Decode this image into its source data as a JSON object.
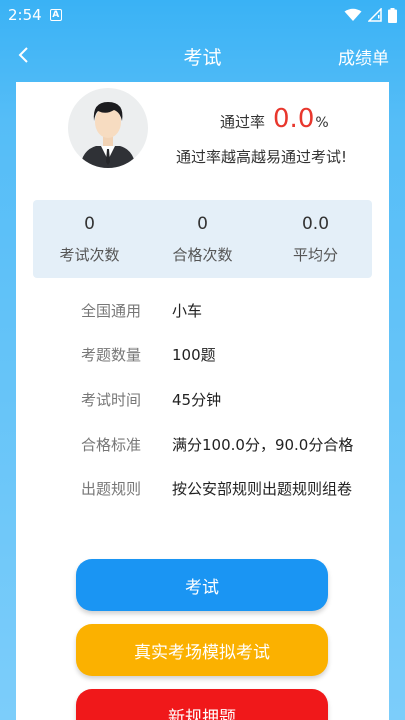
{
  "status_bar": {
    "time": "2:54",
    "notification_badge": "A"
  },
  "app_bar": {
    "title": "考试",
    "action": "成绩单"
  },
  "pass_rate": {
    "label": "通过率",
    "value": "0.0",
    "unit": "%",
    "motto": "通过率越高越易通过考试!"
  },
  "stats": [
    {
      "value": "0",
      "label": "考试次数"
    },
    {
      "value": "0",
      "label": "合格次数"
    },
    {
      "value": "0.0",
      "label": "平均分"
    }
  ],
  "info": [
    {
      "label": "全国通用",
      "value": "小车"
    },
    {
      "label": "考题数量",
      "value": "100题"
    },
    {
      "label": "考试时间",
      "value": "45分钟"
    },
    {
      "label": "合格标准",
      "value": "满分100.0分，90.0分合格"
    },
    {
      "label": "出题规则",
      "value": "按公安部规则出题规则组卷"
    }
  ],
  "buttons": {
    "exam": "考试",
    "mock": "真实考场模拟考试",
    "new_rules": "新规押题"
  },
  "colors": {
    "primary": "#1a95f3",
    "mock": "#fbb100",
    "new_rules": "#f0181a",
    "pass_rate": "#e8372d"
  }
}
